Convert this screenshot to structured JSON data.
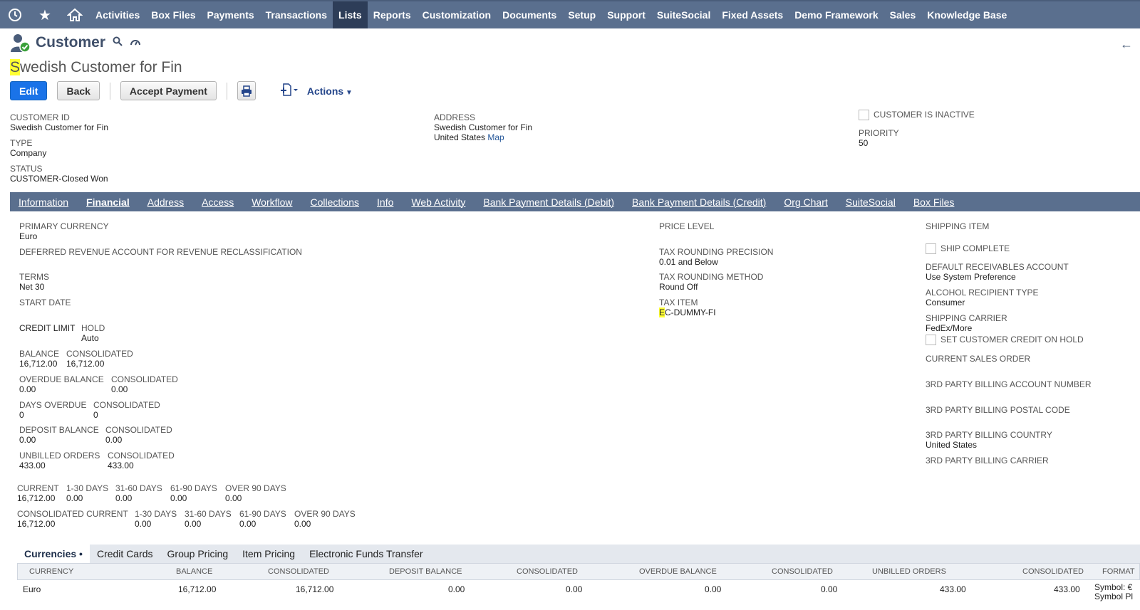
{
  "nav": {
    "items": [
      "Activities",
      "Box Files",
      "Payments",
      "Transactions",
      "Lists",
      "Reports",
      "Customization",
      "Documents",
      "Setup",
      "Support",
      "SuiteSocial",
      "Fixed Assets",
      "Demo Framework",
      "Sales",
      "Knowledge Base"
    ],
    "active": "Lists"
  },
  "header": {
    "record_type": "Customer",
    "title_first": "S",
    "title_rest": "wedish Customer for Fin"
  },
  "buttons": {
    "edit": "Edit",
    "back": "Back",
    "accept_payment": "Accept Payment",
    "actions": "Actions"
  },
  "primary": {
    "customer_id_label": "CUSTOMER ID",
    "customer_id": "Swedish Customer for Fin",
    "type_label": "TYPE",
    "type": "Company",
    "status_label": "STATUS",
    "status": "CUSTOMER-Closed Won",
    "address_label": "ADDRESS",
    "address_line1": "Swedish Customer for Fin",
    "address_line2": "United States",
    "map_link": "Map",
    "inactive_label": "CUSTOMER IS INACTIVE",
    "priority_label": "PRIORITY",
    "priority": "50"
  },
  "tabs": [
    "Information",
    "Financial",
    "Address",
    "Access",
    "Workflow",
    "Collections",
    "Info",
    "Web Activity",
    "Bank Payment Details (Debit)",
    "Bank Payment Details (Credit)",
    "Org Chart",
    "SuiteSocial",
    "Box Files"
  ],
  "active_tab": "Financial",
  "financial": {
    "primary_currency_label": "PRIMARY CURRENCY",
    "primary_currency": "Euro",
    "deferred_label": "DEFERRED REVENUE ACCOUNT FOR REVENUE RECLASSIFICATION",
    "terms_label": "TERMS",
    "terms": "Net 30",
    "start_date_label": "START DATE",
    "credit_limit_label": "CREDIT LIMIT",
    "hold_label": "HOLD",
    "hold": "Auto",
    "balance_label": "BALANCE",
    "consolidated_label": "CONSOLIDATED",
    "balance": "16,712.00",
    "balance_consolidated": "16,712.00",
    "overdue_balance_label": "OVERDUE BALANCE",
    "overdue_balance": "0.00",
    "overdue_consolidated": "0.00",
    "days_overdue_label": "DAYS OVERDUE",
    "days_overdue": "0",
    "days_overdue_consolidated": "0",
    "deposit_balance_label": "DEPOSIT BALANCE",
    "deposit_balance": "0.00",
    "deposit_consolidated": "0.00",
    "unbilled_orders_label": "UNBILLED ORDERS",
    "unbilled_orders": "433.00",
    "unbilled_consolidated": "433.00",
    "aging_labels": [
      "CURRENT",
      "1-30 DAYS",
      "31-60 DAYS",
      "61-90 DAYS",
      "OVER 90 DAYS"
    ],
    "aging_values": [
      "16,712.00",
      "0.00",
      "0.00",
      "0.00",
      "0.00"
    ],
    "cons_aging_labels": [
      "CONSOLIDATED CURRENT",
      "1-30 DAYS",
      "31-60 DAYS",
      "61-90 DAYS",
      "OVER 90 DAYS"
    ],
    "cons_aging_values": [
      "16,712.00",
      "0.00",
      "0.00",
      "0.00",
      "0.00"
    ],
    "price_level_label": "PRICE LEVEL",
    "tax_rounding_precision_label": "TAX ROUNDING PRECISION",
    "tax_rounding_precision": "0.01 and Below",
    "tax_rounding_method_label": "TAX ROUNDING METHOD",
    "tax_rounding_method": "Round Off",
    "tax_item_label": "TAX ITEM",
    "tax_item_first": "E",
    "tax_item_rest": "C-DUMMY-FI",
    "shipping_item_label": "SHIPPING ITEM",
    "ship_complete_label": "SHIP COMPLETE",
    "default_ar_label": "DEFAULT RECEIVABLES ACCOUNT",
    "default_ar": "Use System Preference",
    "alcohol_label": "ALCOHOL RECIPIENT TYPE",
    "alcohol": "Consumer",
    "carrier_label": "SHIPPING CARRIER",
    "carrier": "FedEx/More",
    "credit_hold_label": "SET CUSTOMER CREDIT ON HOLD",
    "current_so_label": "CURRENT SALES ORDER",
    "tp_account_label": "3RD PARTY BILLING ACCOUNT NUMBER",
    "tp_postal_label": "3RD PARTY BILLING POSTAL CODE",
    "tp_country_label": "3RD PARTY BILLING COUNTRY",
    "tp_country": "United States",
    "tp_carrier_label": "3RD PARTY BILLING CARRIER"
  },
  "subtabs": [
    "Currencies",
    "Credit Cards",
    "Group Pricing",
    "Item Pricing",
    "Electronic Funds Transfer"
  ],
  "active_subtab": "Currencies",
  "table": {
    "headers": [
      "CURRENCY",
      "BALANCE",
      "CONSOLIDATED",
      "DEPOSIT BALANCE",
      "CONSOLIDATED",
      "OVERDUE BALANCE",
      "CONSOLIDATED",
      "UNBILLED ORDERS",
      "CONSOLIDATED",
      "FORMAT"
    ],
    "row": [
      "Euro",
      "16,712.00",
      "16,712.00",
      "0.00",
      "0.00",
      "0.00",
      "0.00",
      "433.00",
      "433.00",
      "Symbol: €"
    ],
    "row_extra": "Symbol Pl"
  }
}
